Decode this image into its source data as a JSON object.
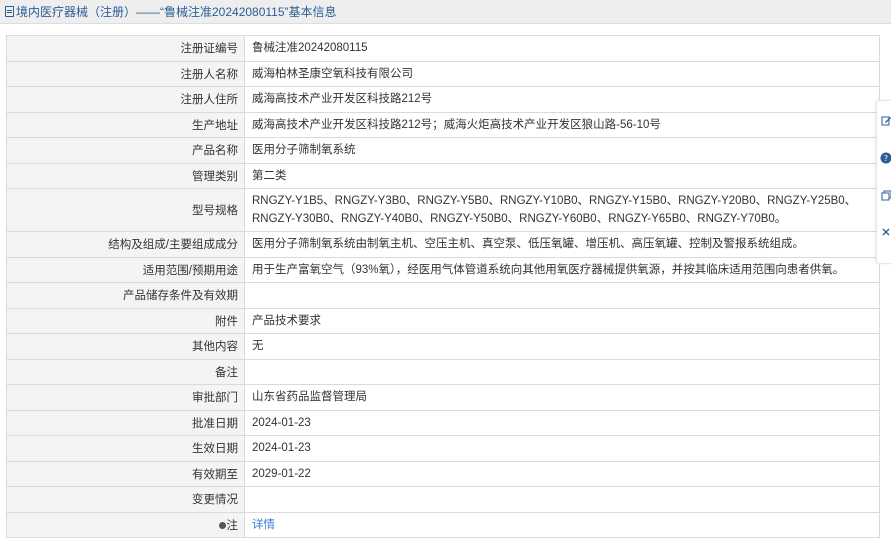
{
  "header": {
    "title": "境内医疗器械（注册）——“鲁械注准20242080115”基本信息"
  },
  "rows": [
    {
      "label": "注册证编号",
      "value": "鲁械注准20242080115"
    },
    {
      "label": "注册人名称",
      "value": "威海柏林圣康空氧科技有限公司"
    },
    {
      "label": "注册人住所",
      "value": "威海高技术产业开发区科技路212号"
    },
    {
      "label": "生产地址",
      "value": "威海高技术产业开发区科技路212号；威海火炬高技术产业开发区狼山路-56-10号"
    },
    {
      "label": "产品名称",
      "value": "医用分子筛制氧系统"
    },
    {
      "label": "管理类别",
      "value": "第二类"
    },
    {
      "label": "型号规格",
      "value": "RNGZY-Y1B5、RNGZY-Y3B0、RNGZY-Y5B0、RNGZY-Y10B0、RNGZY-Y15B0、RNGZY-Y20B0、RNGZY-Y25B0、RNGZY-Y30B0、RNGZY-Y40B0、RNGZY-Y50B0、RNGZY-Y60B0、RNGZY-Y65B0、RNGZY-Y70B0。"
    },
    {
      "label": "结构及组成/主要组成成分",
      "value": "医用分子筛制氧系统由制氧主机、空压主机、真空泵、低压氧罐、增压机、高压氧罐、控制及警报系统组成。"
    },
    {
      "label": "适用范围/预期用途",
      "value": "用于生产富氧空气（93%氧），经医用气体管道系统向其他用氧医疗器械提供氧源，并按其临床适用范围向患者供氧。"
    },
    {
      "label": "产品储存条件及有效期",
      "value": ""
    },
    {
      "label": "附件",
      "value": "产品技术要求"
    },
    {
      "label": "其他内容",
      "value": "无"
    },
    {
      "label": "备注",
      "value": ""
    },
    {
      "label": "审批部门",
      "value": "山东省药品监督管理局"
    },
    {
      "label": "批准日期",
      "value": "2024-01-23"
    },
    {
      "label": "生效日期",
      "value": "2024-01-23"
    },
    {
      "label": "有效期至",
      "value": "2029-01-22"
    },
    {
      "label": "变更情况",
      "value": ""
    }
  ],
  "note": {
    "label": "注",
    "link_text": "详情"
  },
  "icons": {
    "header": "document-icon",
    "note": "pin-icon",
    "side": [
      "edit-icon",
      "help-icon",
      "copy-icon",
      "close-icon"
    ]
  },
  "colors": {
    "header_text": "#2b5d95",
    "link": "#3a7bd5",
    "label_bg": "#f4f4f4"
  }
}
